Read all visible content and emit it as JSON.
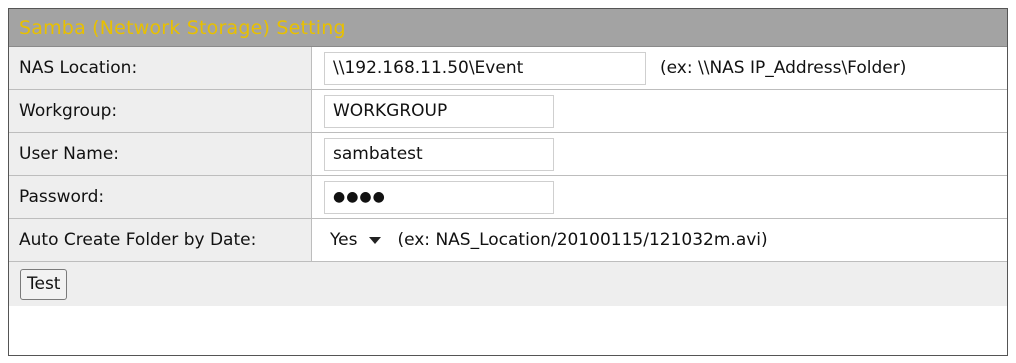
{
  "panel": {
    "title": "Samba (Network Storage) Setting"
  },
  "fields": {
    "nas_location": {
      "label": "NAS Location:",
      "value": "\\\\192.168.11.50\\Event",
      "hint": "(ex: \\\\NAS IP_Address\\Folder)"
    },
    "workgroup": {
      "label": "Workgroup:",
      "value": "WORKGROUP"
    },
    "user_name": {
      "label": "User Name:",
      "value": "sambatest"
    },
    "password": {
      "label": "Password:",
      "masked": "●●●●"
    },
    "auto_create_folder": {
      "label": "Auto Create Folder by Date:",
      "selected": "Yes",
      "hint": "(ex: NAS_Location/20100115/121032m.avi)"
    }
  },
  "buttons": {
    "test_label": "Test"
  },
  "colors": {
    "header_background": "#a3a3a3",
    "header_text": "#e8c000",
    "label_background": "#eeeeee"
  }
}
